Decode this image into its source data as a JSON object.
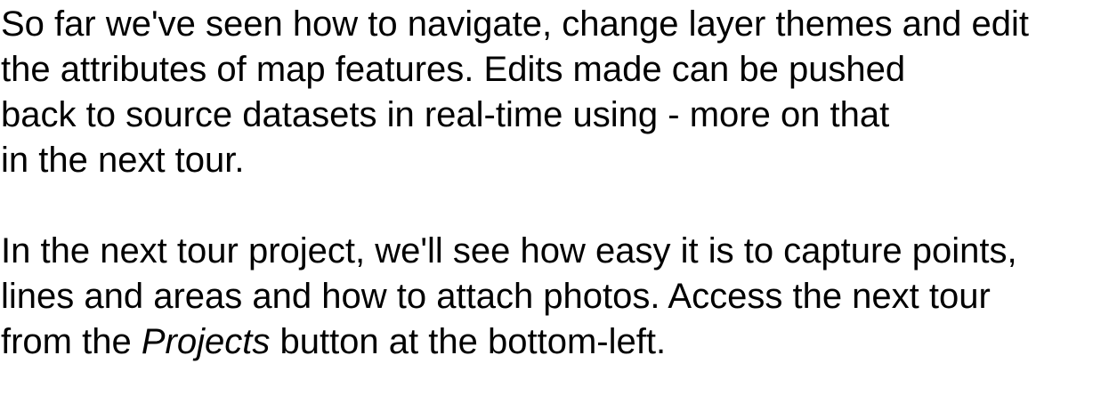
{
  "paragraph1": {
    "line1": "So far we've seen how to navigate, change layer themes and edit",
    "line2": "the attributes of map features. Edits made can be pushed",
    "line3": "back to source datasets in real-time using - more on that",
    "line4": "in the next tour."
  },
  "paragraph2": {
    "line1": "In the next tour project, we'll see how easy it is to capture points,",
    "line2": "lines and areas and how to attach photos. Access the next tour",
    "line3_prefix": "from the ",
    "line3_emphasis": "Projects",
    "line3_suffix": " button at the bottom-left."
  }
}
